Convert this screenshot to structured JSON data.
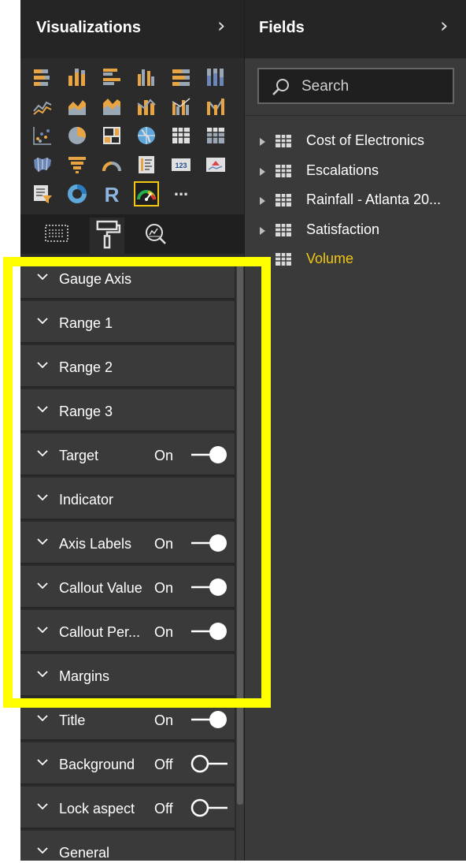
{
  "visualizations": {
    "title": "Visualizations",
    "icons": [
      "stacked-bar-chart-icon",
      "stacked-column-chart-icon",
      "clustered-bar-chart-icon",
      "clustered-column-chart-icon",
      "100-stacked-bar-chart-icon",
      "100-stacked-column-chart-icon",
      "line-chart-icon",
      "area-chart-icon",
      "stacked-area-chart-icon",
      "line-and-stacked-column-icon",
      "line-and-clustered-column-icon",
      "ribbon-chart-icon",
      "scatter-chart-icon",
      "pie-chart-icon",
      "treemap-icon",
      "map-icon",
      "table-icon",
      "matrix-icon",
      "filled-map-icon",
      "funnel-icon",
      "gauge-icon",
      "multi-row-card-icon",
      "card-icon",
      "kpi-icon",
      "slicer-icon",
      "donut-chart-icon",
      "r-visual-icon",
      "gauge-selected-icon",
      "more-visuals-icon"
    ],
    "r_label": "R",
    "more_label": "...",
    "card_value": "123",
    "tabs": [
      "fields-well-icon",
      "format-paint-roller-icon",
      "analytics-icon"
    ],
    "format_cards": [
      {
        "label": "Gauge Axis",
        "state": "",
        "toggle": null
      },
      {
        "label": "Range 1",
        "state": "",
        "toggle": null
      },
      {
        "label": "Range 2",
        "state": "",
        "toggle": null
      },
      {
        "label": "Range 3",
        "state": "",
        "toggle": null
      },
      {
        "label": "Target",
        "state": "On",
        "toggle": true
      },
      {
        "label": "Indicator",
        "state": "",
        "toggle": null
      },
      {
        "label": "Axis Labels",
        "state": "On",
        "toggle": true
      },
      {
        "label": "Callout Value",
        "state": "On",
        "toggle": true
      },
      {
        "label": "Callout Per...",
        "state": "On",
        "toggle": true
      },
      {
        "label": "Margins",
        "state": "",
        "toggle": null
      },
      {
        "label": "Title",
        "state": "On",
        "toggle": true
      },
      {
        "label": "Background",
        "state": "Off",
        "toggle": false
      },
      {
        "label": "Lock aspect",
        "state": "Off",
        "toggle": false
      },
      {
        "label": "General",
        "state": "",
        "toggle": null
      }
    ]
  },
  "fields": {
    "title": "Fields",
    "search_placeholder": "Search",
    "tables": [
      {
        "name": "Cost of Electronics",
        "active": false
      },
      {
        "name": "Escalations",
        "active": false
      },
      {
        "name": "Rainfall - Atlanta 20...",
        "active": false
      },
      {
        "name": "Satisfaction",
        "active": false
      },
      {
        "name": "Volume",
        "active": true
      }
    ]
  },
  "colors": {
    "accent_yellow": "#f2c811",
    "highlight": "#ffff00",
    "pane_bg": "#2b2b2b",
    "card_bg": "#3a3a3a"
  }
}
